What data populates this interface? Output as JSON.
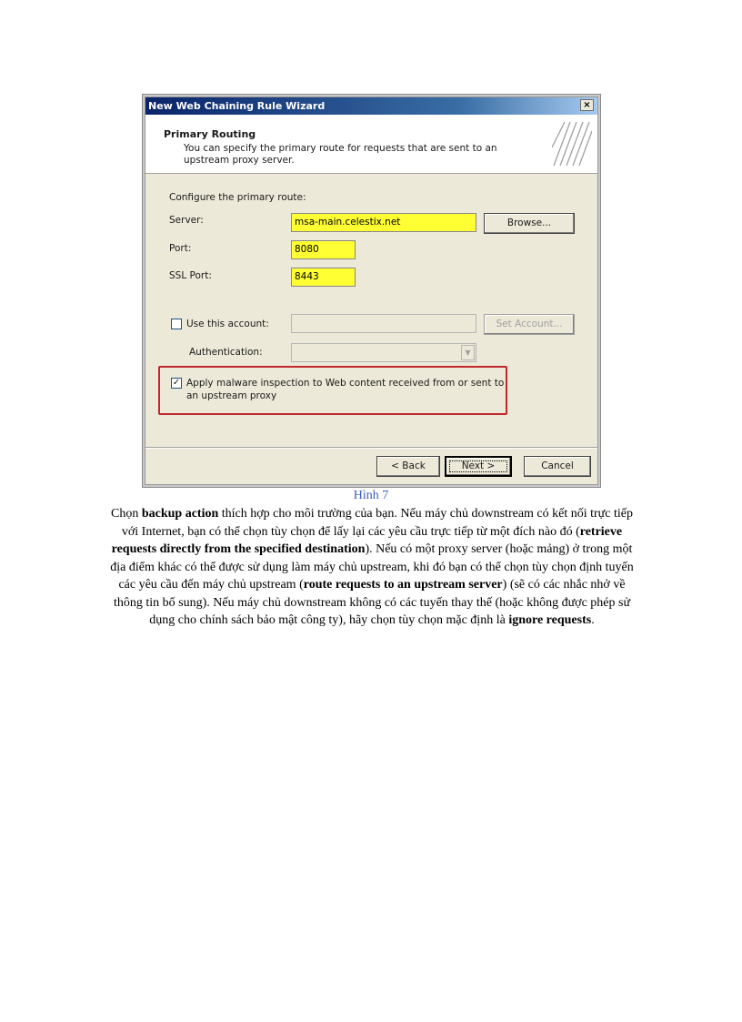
{
  "wizard": {
    "title": "New Web Chaining Rule Wizard",
    "close_label": "×",
    "header": {
      "title": "Primary Routing",
      "description": "You can specify the primary route for requests that are sent to an upstream proxy server."
    },
    "configure_label": "Configure the primary route:",
    "server": {
      "label": "Server:",
      "value": "msa-main.celestix.net"
    },
    "browse_button": "Browse...",
    "port": {
      "label": "Port:",
      "value": "8080"
    },
    "ssl_port": {
      "label": "SSL Port:",
      "value": "8443"
    },
    "use_account": {
      "label": "Use this account:",
      "checked": false,
      "value": ""
    },
    "set_account_button": "Set Account...",
    "authentication": {
      "label": "Authentication:",
      "value": ""
    },
    "malware_inspection": {
      "label": "Apply malware inspection to Web content received from or sent to an upstream proxy",
      "checked": true
    },
    "buttons": {
      "back": "< Back",
      "next": "Next >",
      "cancel": "Cancel"
    },
    "colors": {
      "highlight_field": "#ffff33",
      "annotation_border": "#c0282c",
      "titlebar": "#0a246a"
    }
  },
  "caption": "Hình 7",
  "paragraph": {
    "p1": "Chọn ",
    "b1": "backup action",
    "p2": " thích hợp cho môi trường của bạn. Nếu máy chủ downstream có kết nối trực tiếp với Internet, bạn có thể chọn tùy chọn để lấy lại các yêu cầu trực tiếp từ một đích nào đó (",
    "b2": "retrieve requests directly from the specified destination",
    "p3": "). Nếu có một proxy server (hoặc mảng) ở trong một địa điểm khác có thể được sử dụng làm máy chủ upstream, khi đó bạn có thể chọn tùy chọn định tuyến các yêu cầu đến máy chủ upstream (",
    "b3": "route requests to an upstream server",
    "p4": ") (sẽ có các nhắc nhở về thông tin bổ sung). Nếu máy chủ downstream không có các tuyến thay thế (hoặc không được phép sử dụng cho chính sách bảo mật công ty), hãy chọn tùy chọn mặc định là ",
    "b4": "ignore requests",
    "p5": "."
  }
}
